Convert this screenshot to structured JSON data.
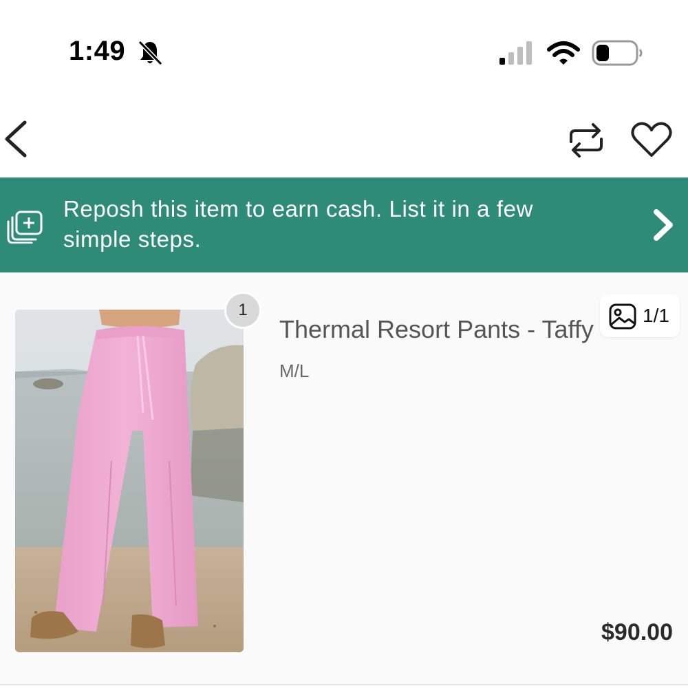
{
  "status_bar": {
    "time": "1:49",
    "icons": [
      "bell-slash-icon",
      "cellular-signal-icon",
      "wifi-icon",
      "battery-icon"
    ]
  },
  "nav": {
    "icons": [
      "chevron-left-icon",
      "repost-icon",
      "heart-icon"
    ]
  },
  "banner": {
    "text": "Reposh this item to earn cash. List it in a few simple steps.",
    "icons": [
      "add-listing-icon",
      "chevron-right-icon"
    ],
    "background_color": "#2e8b77"
  },
  "listing": {
    "photo_badge": "1",
    "title": "Thermal Resort Pants - Taffy",
    "size": "M/L",
    "image_counter": "1/1",
    "image_counter_icon": "image-icon",
    "price": "$90.00"
  }
}
